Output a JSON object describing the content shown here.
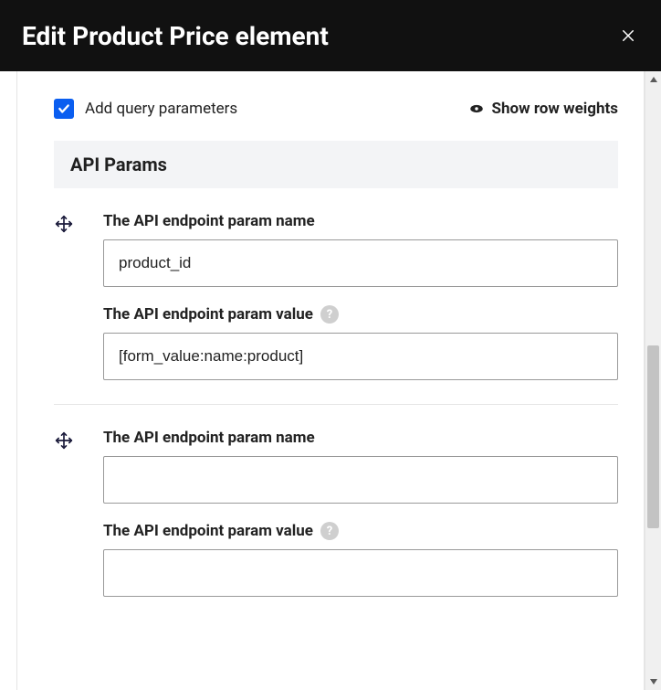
{
  "header": {
    "title": "Edit Product Price element"
  },
  "form": {
    "add_query_params_label": "Add query parameters",
    "show_row_weights_label": "Show row weights",
    "section_header": "API Params",
    "params": [
      {
        "name_label": "The API endpoint param name",
        "name_value": "product_id",
        "value_label": "The API endpoint param value",
        "value_value": "[form_value:name:product]"
      },
      {
        "name_label": "The API endpoint param name",
        "name_value": "",
        "value_label": "The API endpoint param value",
        "value_value": ""
      }
    ],
    "help_symbol": "?"
  }
}
